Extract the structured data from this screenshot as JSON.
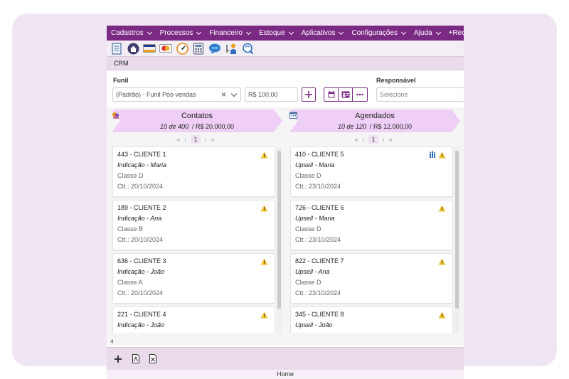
{
  "menu": {
    "items": [
      "Cadastros",
      "Processos",
      "Financeiro",
      "Estoque",
      "Aplicativos",
      "Configurações",
      "Ajuda",
      "+Recu"
    ]
  },
  "toolbar": {
    "icons": [
      "document-icon",
      "home-icon",
      "visa-card-icon",
      "mastercard-icon",
      "dashboard-gauge-icon",
      "calculator-icon",
      "chat-bubble-icon",
      "user-key-icon",
      "support-chat-icon"
    ]
  },
  "breadcrumb": {
    "label": "CRM"
  },
  "filters": {
    "funil_label": "Funil",
    "funil_value": "(Padrão) - Funil Pós-vendas",
    "value_field": "R$ 100,00",
    "responsavel_label": "Responsável",
    "responsavel_placeholder": "Selecione"
  },
  "columns": [
    {
      "title": "Contatos",
      "count": "10 de 400",
      "total": "/ R$ 20.000,00",
      "page": "1",
      "cards": [
        {
          "title": "443 - CLIENTE 1",
          "source": "Indicação - Maria",
          "classe": "Classe D",
          "ctt": "Ctt.: 20/10/2024"
        },
        {
          "title": "189 - CLIENTE 2",
          "source": "Indicação - Ana",
          "classe": "Classe B",
          "ctt": "Ctt.: 20/10/2024"
        },
        {
          "title": "636 - CLIENTE 3",
          "source": "Indicação - João",
          "classe": "Classe A",
          "ctt": "Ctt.: 20/10/2024"
        },
        {
          "title": "221 - CLIENTE 4",
          "source": "Indicação - João",
          "classe": "",
          "ctt": ""
        }
      ]
    },
    {
      "title": "Agendados",
      "count": "10 de 120",
      "total": "/ R$ 12.000,00",
      "page": "1",
      "cards": [
        {
          "title": "410 - CLIENTE 5",
          "source": "Upsell - Maria",
          "classe": "Classe D",
          "ctt": "Ctt.: 23/10/2024"
        },
        {
          "title": "726 - CLIENTE 6",
          "source": "Upsell - Maria",
          "classe": "Classe D",
          "ctt": "Ctt.: 23/10/2024"
        },
        {
          "title": "822 - CLIENTE 7",
          "source": "Upsell - Ana",
          "classe": "Classe D",
          "ctt": "Ctt.: 23/10/2024"
        },
        {
          "title": "345 - CLIENTE 8",
          "source": "Upsell - João",
          "classe": "",
          "ctt": ""
        }
      ]
    }
  ],
  "pager": {
    "first": "«",
    "prev": "‹",
    "next": "›",
    "last": "»"
  },
  "status_bar": {
    "label": "Home"
  },
  "colors": {
    "brand": "#7b2a84",
    "column_header": "#efcff5",
    "warning": "#f2c12e",
    "background": "#f0e5f2"
  }
}
